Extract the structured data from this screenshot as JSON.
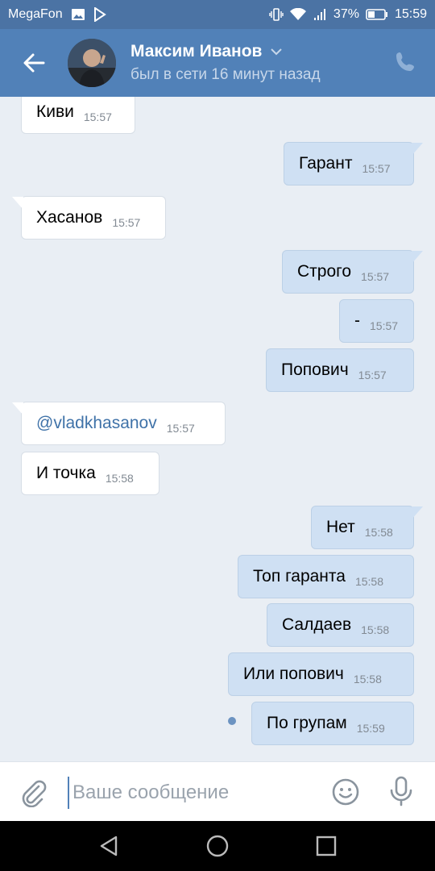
{
  "status_bar": {
    "carrier": "MegaFon",
    "battery": "37%",
    "time": "15:59"
  },
  "header": {
    "name": "Максим Иванов",
    "status": "был в сети 16 минут назад"
  },
  "messages": [
    {
      "dir": "in",
      "text": "Киви",
      "time": "15:57"
    },
    {
      "dir": "out",
      "text": "Гарант",
      "time": "15:57"
    },
    {
      "dir": "in",
      "text": "Хасанов",
      "time": "15:57"
    },
    {
      "dir": "out",
      "text": "Строго",
      "time": "15:57"
    },
    {
      "dir": "out",
      "text": "-",
      "time": "15:57"
    },
    {
      "dir": "out",
      "text": "Попович",
      "time": "15:57"
    },
    {
      "dir": "in",
      "text": "@vladkhasanov",
      "time": "15:57",
      "link": true
    },
    {
      "dir": "in",
      "text": "И точка",
      "time": "15:58"
    },
    {
      "dir": "out",
      "text": "Нет",
      "time": "15:58"
    },
    {
      "dir": "out",
      "text": "Топ гаранта",
      "time": "15:58"
    },
    {
      "dir": "out",
      "text": "Салдаев",
      "time": "15:58"
    },
    {
      "dir": "out",
      "text": "Или попович",
      "time": "15:58"
    },
    {
      "dir": "out",
      "text": "По групам",
      "time": "15:59",
      "unread": true
    }
  ],
  "composer": {
    "placeholder": "Ваше сообщение"
  },
  "colors": {
    "header": "#5181b8",
    "status_bar": "#4b73a4",
    "chat_bg": "#e9eef4",
    "out_bubble": "#cfe0f3",
    "in_bubble": "#ffffff"
  }
}
